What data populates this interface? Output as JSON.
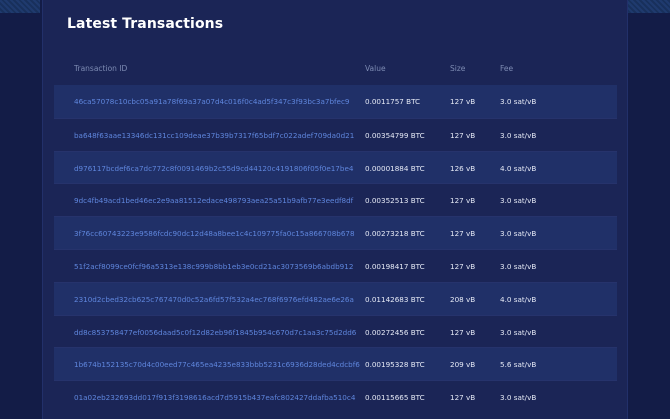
{
  "panel": {
    "title": "Latest Transactions"
  },
  "table": {
    "columns": [
      "Transaction ID",
      "Value",
      "Size",
      "Fee"
    ],
    "rows": [
      {
        "id": "46ca57078c10cbc05a91a78f69a37a07d4c016f0c4ad5f347c3f93bc3a7bfec9",
        "value": "0.0011757 BTC",
        "size": "127 vB",
        "fee": "3.0 sat/vB"
      },
      {
        "id": "ba648f63aae13346dc131cc109deae37b39b7317f65bdf7c022adef709da0d21",
        "value": "0.00354799 BTC",
        "size": "127 vB",
        "fee": "3.0 sat/vB"
      },
      {
        "id": "d976117bcdef6ca7dc772c8f0091469b2c55d9cd44120c4191806f05f0e17be4",
        "value": "0.00001884 BTC",
        "size": "126 vB",
        "fee": "4.0 sat/vB"
      },
      {
        "id": "9dc4fb49acd1bed46ec2e9aa81512edace498793aea25a51b9afb77e3eedf8df",
        "value": "0.00352513 BTC",
        "size": "127 vB",
        "fee": "3.0 sat/vB"
      },
      {
        "id": "3f76cc60743223e9586fcdc90dc12d48a8bee1c4c109775fa0c15a866708b678",
        "value": "0.00273218 BTC",
        "size": "127 vB",
        "fee": "3.0 sat/vB"
      },
      {
        "id": "51f2acf8099ce0fcf96a5313e138c999b8bb1eb3e0cd21ac3073569b6abdb912",
        "value": "0.00198417 BTC",
        "size": "127 vB",
        "fee": "3.0 sat/vB"
      },
      {
        "id": "2310d2cbed32cb625c767470d0c52a6fd57f532a4ec768f6976efd482ae6e26a",
        "value": "0.01142683 BTC",
        "size": "208 vB",
        "fee": "4.0 sat/vB"
      },
      {
        "id": "dd8c853758477ef0056daad5c0f12d82eb96f1845b954c670d7c1aa3c75d2dd6",
        "value": "0.00272456 BTC",
        "size": "127 vB",
        "fee": "3.0 sat/vB"
      },
      {
        "id": "1b674b152135c70d4c00eed77c465ea4235e833bbb5231c6936d28ded4cdcbf6",
        "value": "0.00195328 BTC",
        "size": "209 vB",
        "fee": "5.6 sat/vB"
      },
      {
        "id": "01a02eb232693dd017f913f3198616acd7d5915b437eafc802427ddafba510c4",
        "value": "0.00115665 BTC",
        "size": "127 vB",
        "fee": "3.0 sat/vB"
      }
    ]
  }
}
